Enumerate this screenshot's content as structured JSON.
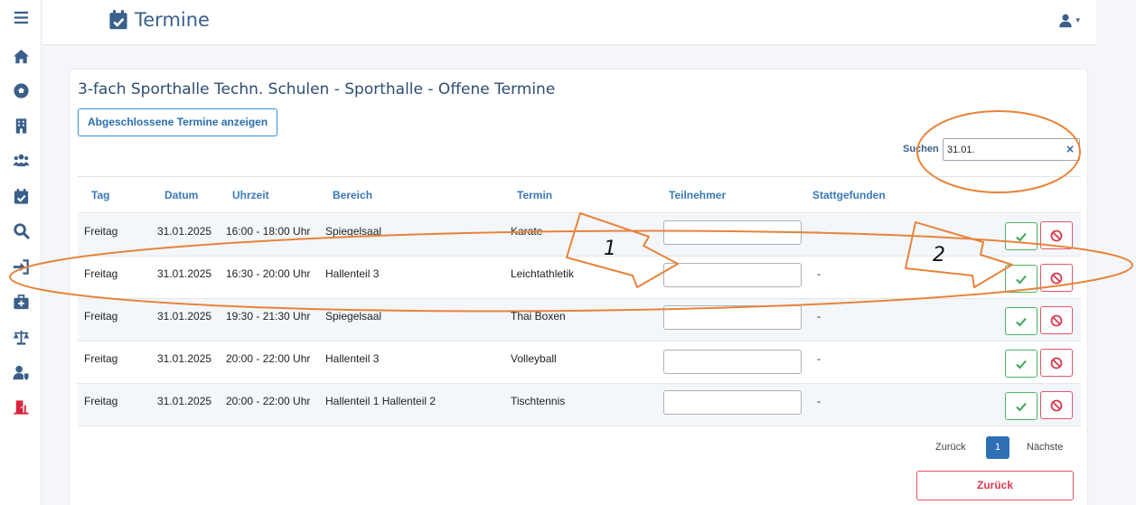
{
  "header": {
    "title": "Termine",
    "title_icon": "calendar-check-icon",
    "user_icon": "user-icon",
    "caret": "▾"
  },
  "sidebar": {
    "items": [
      {
        "icon": "menu-icon"
      },
      {
        "icon": "home-icon"
      },
      {
        "icon": "soccer-ball-icon"
      },
      {
        "icon": "building-icon"
      },
      {
        "icon": "users-icon"
      },
      {
        "icon": "calendar-check-icon"
      },
      {
        "icon": "search-icon"
      },
      {
        "icon": "sign-in-icon"
      },
      {
        "icon": "medical-kit-icon"
      },
      {
        "icon": "scale-icon"
      },
      {
        "icon": "user-shield-icon"
      },
      {
        "icon": "exit-door-icon"
      }
    ]
  },
  "card": {
    "title": "3-fach Sporthalle Techn. Schulen - Sporthalle - Offene Termine",
    "show_closed_label": "Abgeschlossene Termine anzeigen",
    "search": {
      "label": "Suchen",
      "value": "31.01.",
      "clear": "×"
    }
  },
  "table": {
    "headers": [
      "Tag",
      "Datum",
      "Uhrzeit",
      "Bereich",
      "Termin",
      "Teilnehmer",
      "Stattgefunden"
    ],
    "rows": [
      {
        "tag": "Freitag",
        "datum": "31.01.2025",
        "uhrzeit": "16:00 - 18:00 Uhr",
        "bereich": "Spiegelsaal",
        "termin": "Karate",
        "stattgefunden": "-"
      },
      {
        "tag": "Freitag",
        "datum": "31.01.2025",
        "uhrzeit": "16:30 - 20:00 Uhr",
        "bereich": "Hallenteil 3",
        "termin": "Leichtathletik",
        "stattgefunden": "-"
      },
      {
        "tag": "Freitag",
        "datum": "31.01.2025",
        "uhrzeit": "19:30 - 21:30 Uhr",
        "bereich": "Spiegelsaal",
        "termin": "Thai Boxen",
        "stattgefunden": "-"
      },
      {
        "tag": "Freitag",
        "datum": "31.01.2025",
        "uhrzeit": "20:00 - 22:00 Uhr",
        "bereich": "Hallenteil 3",
        "termin": "Volleyball",
        "stattgefunden": "-"
      },
      {
        "tag": "Freitag",
        "datum": "31.01.2025",
        "uhrzeit": "20:00 - 22:00 Uhr",
        "bereich": "Hallenteil 1 Hallenteil 2",
        "termin": "Tischtennis",
        "stattgefunden": "-"
      }
    ]
  },
  "pagination": {
    "prev": "Zurück",
    "current": "1",
    "next": "Nächste"
  },
  "back_button": "Zurück",
  "annotations": {
    "label_1": "1",
    "label_2": "2",
    "color": "#e8833a"
  },
  "colors": {
    "primary": "#3a5f8a",
    "accent": "#2e6fb5",
    "success": "#4cb463",
    "danger": "#e0566a"
  }
}
